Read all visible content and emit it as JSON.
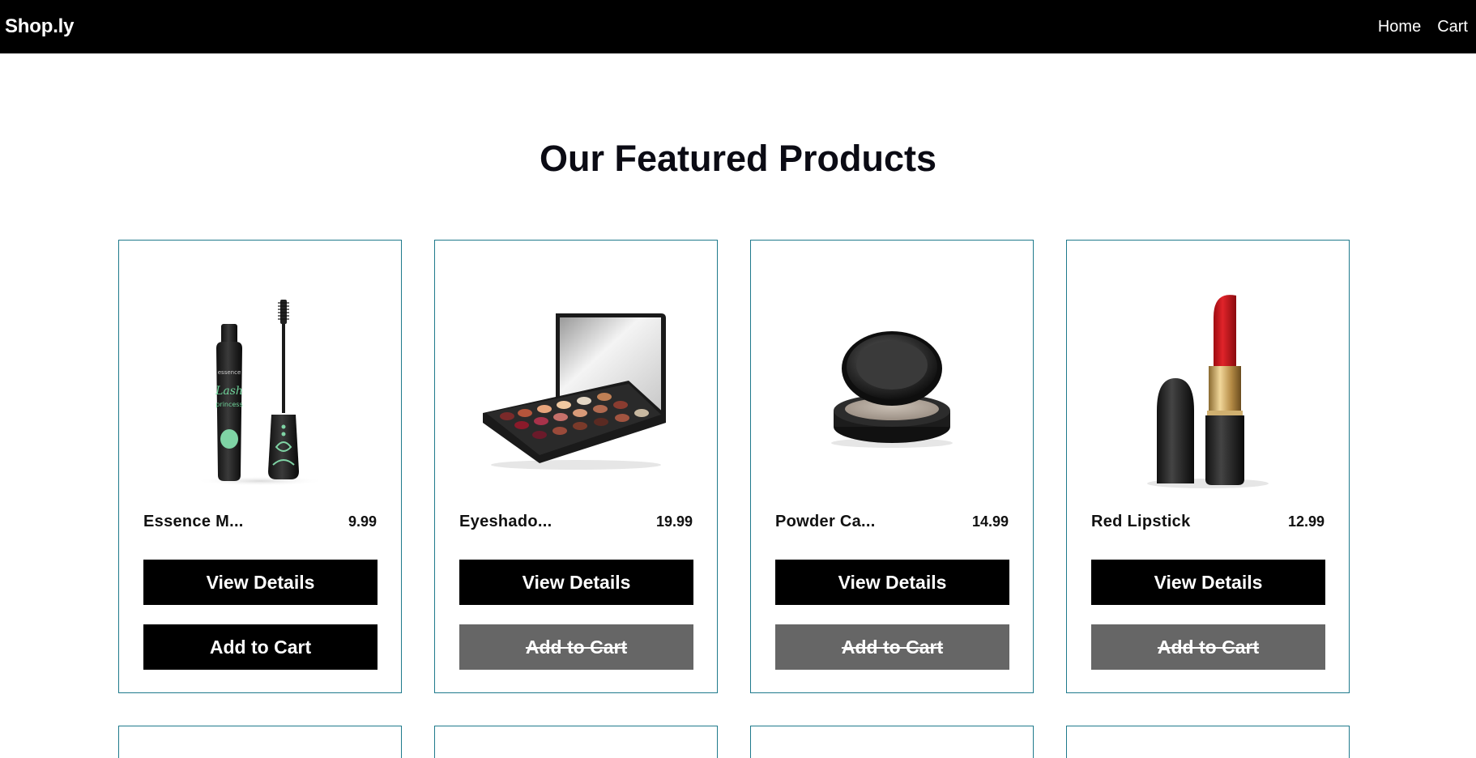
{
  "nav": {
    "brand": "Shop.ly",
    "links": [
      "Home",
      "Cart"
    ]
  },
  "page": {
    "title": "Our Featured Products"
  },
  "products": [
    {
      "name": "Essence M...",
      "price": "9.99",
      "image": "mascara-image",
      "details_label": "View Details",
      "cart_label": "Add to Cart",
      "cart_enabled": true
    },
    {
      "name": "Eyeshado...",
      "price": "19.99",
      "image": "eyeshadow-palette-image",
      "details_label": "View Details",
      "cart_label": "Add to Cart",
      "cart_enabled": false
    },
    {
      "name": "Powder Ca...",
      "price": "14.99",
      "image": "powder-compact-image",
      "details_label": "View Details",
      "cart_label": "Add to Cart",
      "cart_enabled": false
    },
    {
      "name": "Red Lipstick",
      "price": "12.99",
      "image": "lipstick-image",
      "details_label": "View Details",
      "cart_label": "Add to Cart",
      "cart_enabled": false
    }
  ],
  "colors": {
    "nav_bg": "#000000",
    "card_border": "#1f7a8c",
    "button_bg": "#000000",
    "button_disabled_bg": "#666666"
  }
}
